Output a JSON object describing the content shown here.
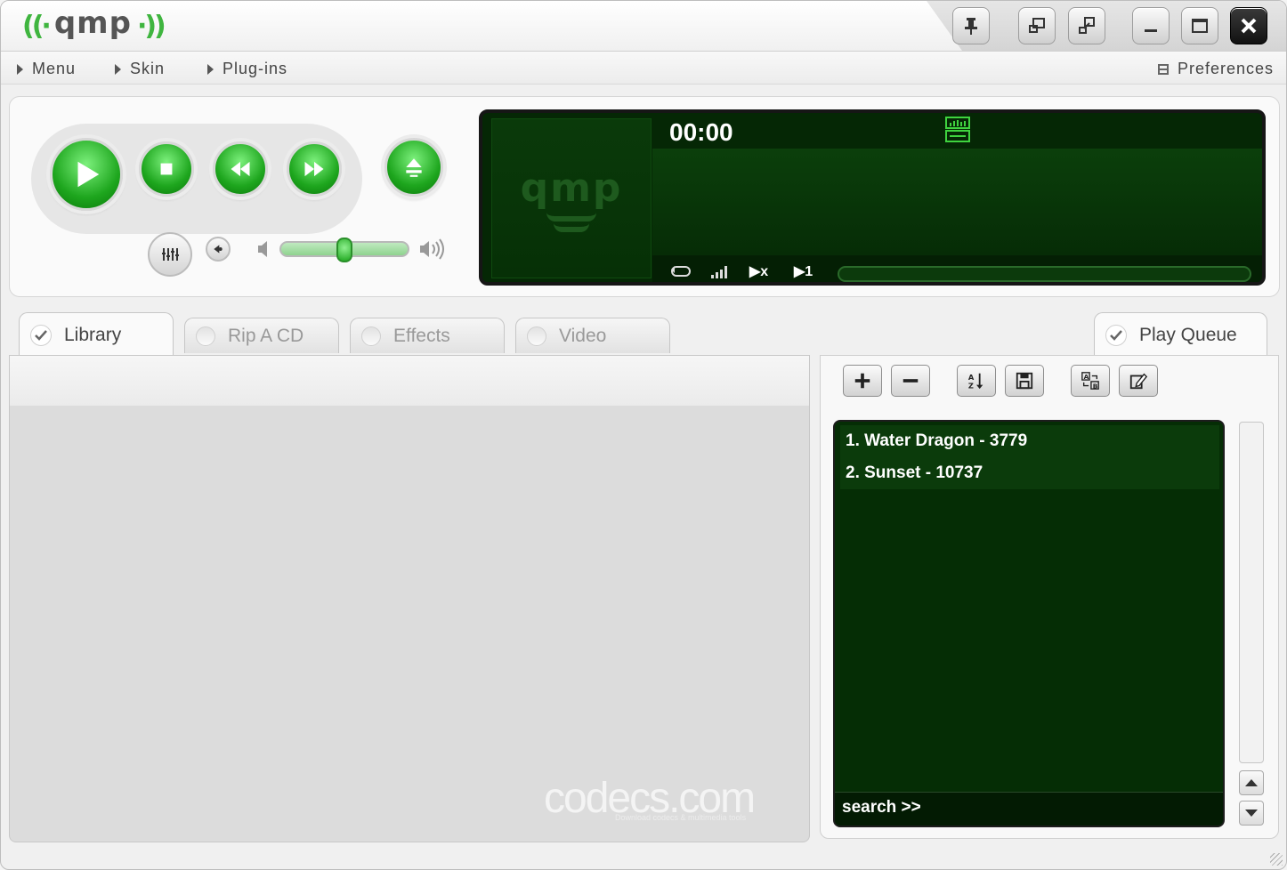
{
  "app": {
    "name": "qmp",
    "waves_left": "((·",
    "waves_right": "·))"
  },
  "menu": {
    "items": [
      "Menu",
      "Skin",
      "Plug-ins"
    ],
    "preferences": "Preferences"
  },
  "display": {
    "time": "00:00",
    "album_text": "qmp",
    "shuffle_label": "▶x",
    "repeat_one_label": "▶1",
    "progress": 0
  },
  "volume": {
    "level": 0.5
  },
  "tabs": {
    "library": "Library",
    "rip": "Rip A CD",
    "effects": "Effects",
    "video": "Video",
    "play_queue": "Play Queue"
  },
  "queue": {
    "items": [
      "1. Water Dragon - 3779",
      "2. Sunset - 10737"
    ],
    "search": "search >>"
  },
  "library": {
    "watermark": "codecs.com",
    "watermark_sub": "Download codecs & multimedia tools"
  },
  "colors": {
    "accent_green": "#22b522",
    "display_bg": "#052705",
    "queue_bg": "#052d05"
  }
}
